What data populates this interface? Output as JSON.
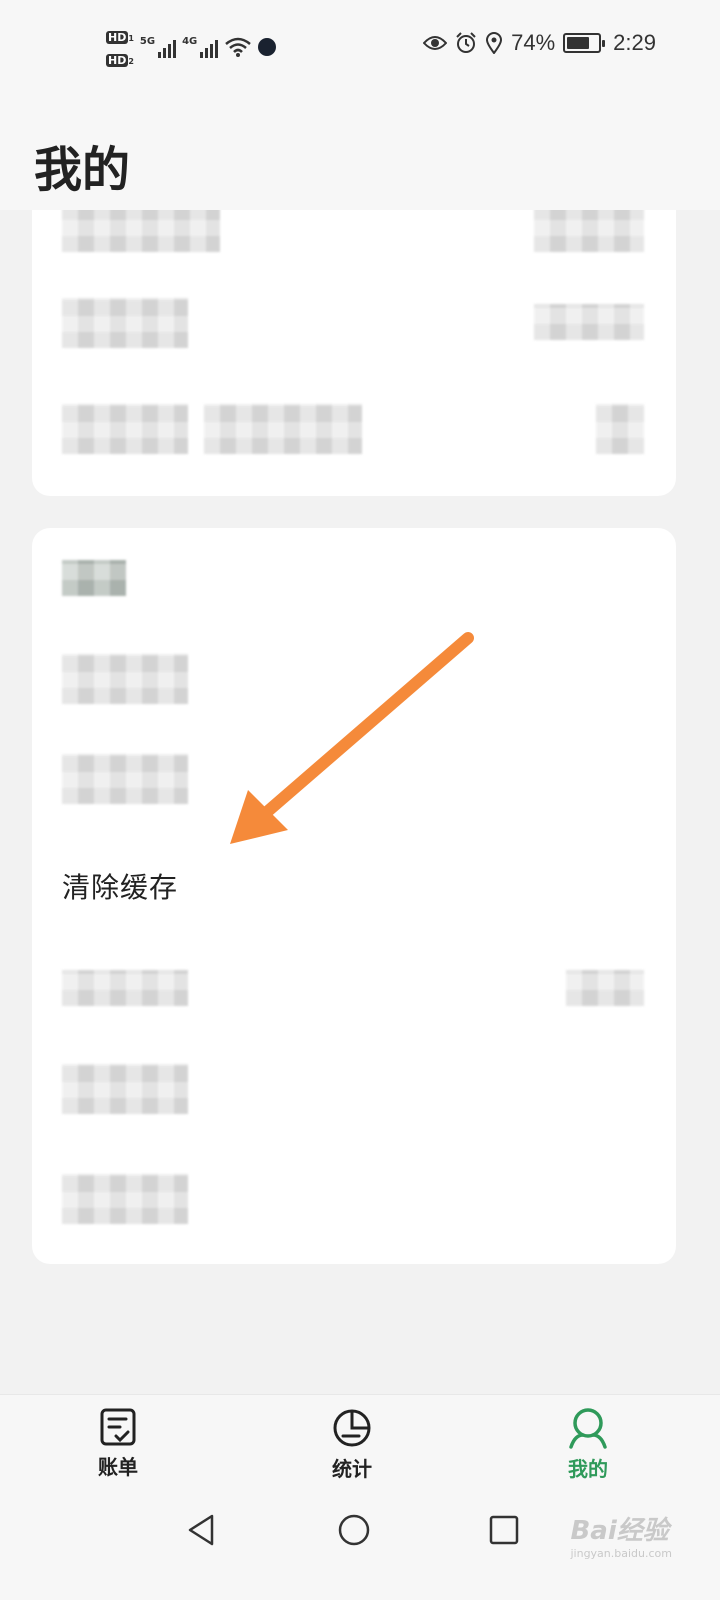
{
  "status_bar": {
    "sim1": "HD",
    "sim1_index": "1",
    "sim2": "HD",
    "sim2_index": "2",
    "network_1": "5G",
    "network_2": "4G",
    "battery_percent": "74%",
    "battery_level": 0.74,
    "time": "2:29",
    "icons": [
      "eye-icon",
      "alarm-icon",
      "location-icon"
    ]
  },
  "header": {
    "title": "我的"
  },
  "settings_card_2": {
    "clear_cache_label": "清除缓存"
  },
  "bottom_nav": {
    "items": [
      {
        "label": "账单",
        "icon": "bill-icon",
        "active": false
      },
      {
        "label": "统计",
        "icon": "pie-chart-icon",
        "active": false
      },
      {
        "label": "我的",
        "icon": "profile-icon",
        "active": true
      }
    ]
  },
  "watermark": {
    "brand": "Bai经验",
    "url": "jingyan.baidu.com"
  },
  "colors": {
    "accent": "#2f9a5a",
    "arrow": "#f58a3a",
    "background": "#f2f2f2",
    "card": "#ffffff"
  }
}
